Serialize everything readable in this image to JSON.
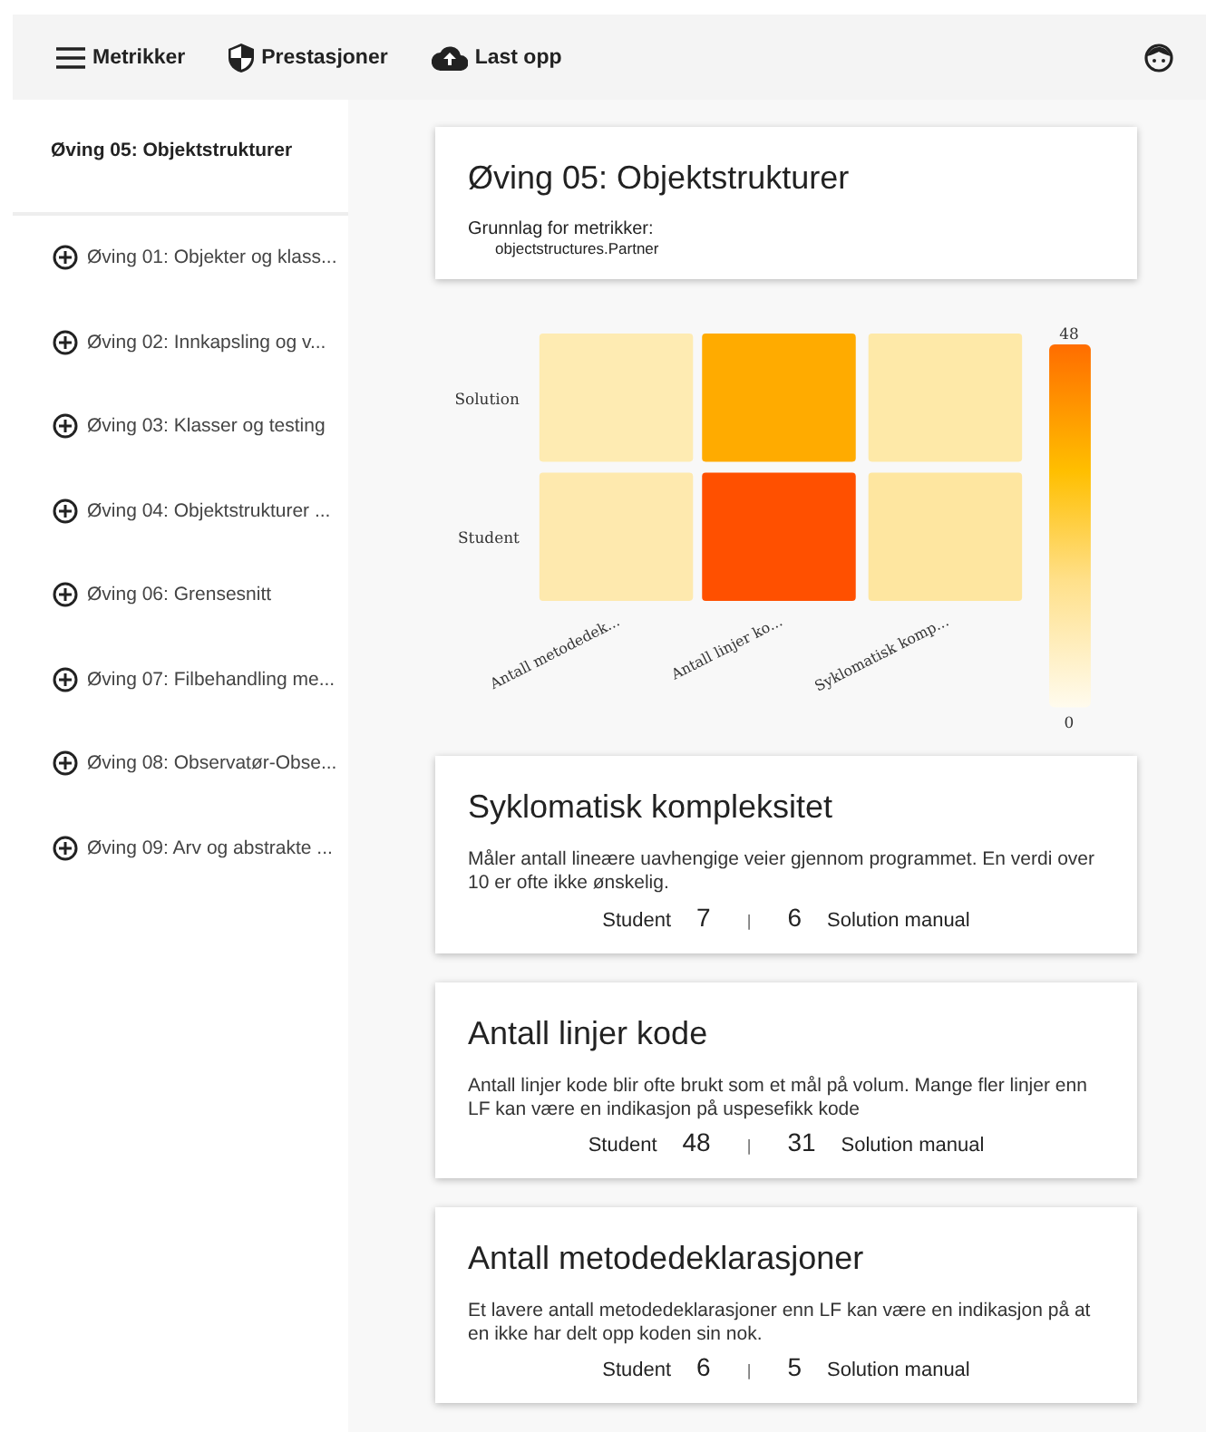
{
  "toolbar": {
    "items": [
      {
        "kind": "menu",
        "label": "Metrikker"
      },
      {
        "kind": "shield",
        "label": "Prestasjoner"
      },
      {
        "kind": "upload",
        "label": "Last opp"
      }
    ]
  },
  "sidebar": {
    "title": "Øving 05: Objektstrukturer",
    "items": [
      {
        "label": "Øving 01: Objekter og klass..."
      },
      {
        "label": "Øving 02: Innkapsling og v..."
      },
      {
        "label": "Øving 03: Klasser og testing"
      },
      {
        "label": "Øving 04: Objektstrukturer ..."
      },
      {
        "label": "Øving 06: Grensesnitt"
      },
      {
        "label": "Øving 07: Filbehandling me..."
      },
      {
        "label": "Øving 08: Observatør-Obse..."
      },
      {
        "label": "Øving 09: Arv og abstrakte ..."
      }
    ]
  },
  "header_card": {
    "title": "Øving 05: Objektstrukturer",
    "subtitle": "Grunnlag for metrikker:",
    "class_name": "objectstructures.Partner"
  },
  "heatmap": {
    "columns": [
      "Antall metodedek...",
      "Antall linjer ko...",
      "Syklomatisk komp..."
    ],
    "rows": [
      {
        "label": "Solution",
        "cells": [
          {
            "color": "#feebb2"
          },
          {
            "color": "#ffab00"
          },
          {
            "color": "#fee9a8"
          }
        ]
      },
      {
        "label": "Student",
        "cells": [
          {
            "color": "#fee9ae"
          },
          {
            "color": "#ff5000"
          },
          {
            "color": "#fee6a0"
          }
        ]
      }
    ],
    "scale_max": "48",
    "scale_min": "0"
  },
  "metrics": [
    {
      "title": "Syklomatisk kompleksitet",
      "description": "Måler antall lineære uavhengige veier gjennom programmet. En verdi over 10 er ofte ikke ønskelig.",
      "student_label": "Student",
      "student_value": "7",
      "separator": "|",
      "solution_value": "6",
      "solution_label": "Solution manual"
    },
    {
      "title": "Antall linjer kode",
      "description": "Antall linjer kode blir ofte brukt som et mål på volum. Mange fler linjer enn LF kan være en indikasjon på uspesefikk kode",
      "student_label": "Student",
      "student_value": "48",
      "separator": "|",
      "solution_value": "31",
      "solution_label": "Solution manual"
    },
    {
      "title": "Antall metodedeklarasjoner",
      "description": "Et lavere antall metodedeklarasjoner enn LF kan være en indikasjon på at en ikke har delt opp koden sin nok.",
      "student_label": "Student",
      "student_value": "6",
      "separator": "|",
      "solution_value": "5",
      "solution_label": "Solution manual"
    }
  ]
}
